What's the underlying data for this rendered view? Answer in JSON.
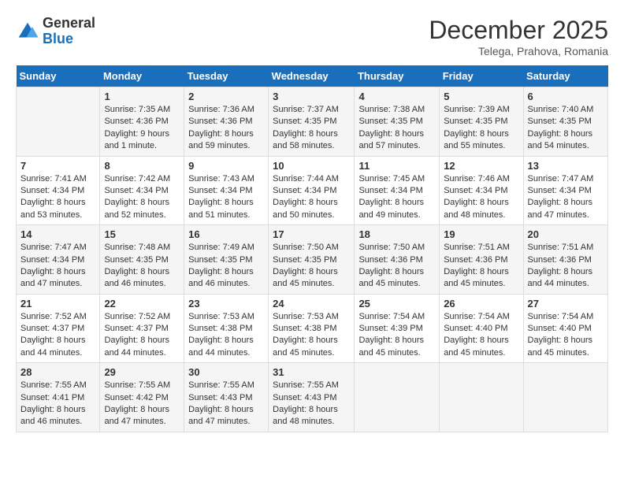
{
  "logo": {
    "general": "General",
    "blue": "Blue"
  },
  "header": {
    "month": "December 2025",
    "location": "Telega, Prahova, Romania"
  },
  "days_of_week": [
    "Sunday",
    "Monday",
    "Tuesday",
    "Wednesday",
    "Thursday",
    "Friday",
    "Saturday"
  ],
  "weeks": [
    [
      {
        "day": "",
        "info": ""
      },
      {
        "day": "1",
        "info": "Sunrise: 7:35 AM\nSunset: 4:36 PM\nDaylight: 9 hours\nand 1 minute."
      },
      {
        "day": "2",
        "info": "Sunrise: 7:36 AM\nSunset: 4:36 PM\nDaylight: 8 hours\nand 59 minutes."
      },
      {
        "day": "3",
        "info": "Sunrise: 7:37 AM\nSunset: 4:35 PM\nDaylight: 8 hours\nand 58 minutes."
      },
      {
        "day": "4",
        "info": "Sunrise: 7:38 AM\nSunset: 4:35 PM\nDaylight: 8 hours\nand 57 minutes."
      },
      {
        "day": "5",
        "info": "Sunrise: 7:39 AM\nSunset: 4:35 PM\nDaylight: 8 hours\nand 55 minutes."
      },
      {
        "day": "6",
        "info": "Sunrise: 7:40 AM\nSunset: 4:35 PM\nDaylight: 8 hours\nand 54 minutes."
      }
    ],
    [
      {
        "day": "7",
        "info": "Sunrise: 7:41 AM\nSunset: 4:34 PM\nDaylight: 8 hours\nand 53 minutes."
      },
      {
        "day": "8",
        "info": "Sunrise: 7:42 AM\nSunset: 4:34 PM\nDaylight: 8 hours\nand 52 minutes."
      },
      {
        "day": "9",
        "info": "Sunrise: 7:43 AM\nSunset: 4:34 PM\nDaylight: 8 hours\nand 51 minutes."
      },
      {
        "day": "10",
        "info": "Sunrise: 7:44 AM\nSunset: 4:34 PM\nDaylight: 8 hours\nand 50 minutes."
      },
      {
        "day": "11",
        "info": "Sunrise: 7:45 AM\nSunset: 4:34 PM\nDaylight: 8 hours\nand 49 minutes."
      },
      {
        "day": "12",
        "info": "Sunrise: 7:46 AM\nSunset: 4:34 PM\nDaylight: 8 hours\nand 48 minutes."
      },
      {
        "day": "13",
        "info": "Sunrise: 7:47 AM\nSunset: 4:34 PM\nDaylight: 8 hours\nand 47 minutes."
      }
    ],
    [
      {
        "day": "14",
        "info": "Sunrise: 7:47 AM\nSunset: 4:34 PM\nDaylight: 8 hours\nand 47 minutes."
      },
      {
        "day": "15",
        "info": "Sunrise: 7:48 AM\nSunset: 4:35 PM\nDaylight: 8 hours\nand 46 minutes."
      },
      {
        "day": "16",
        "info": "Sunrise: 7:49 AM\nSunset: 4:35 PM\nDaylight: 8 hours\nand 46 minutes."
      },
      {
        "day": "17",
        "info": "Sunrise: 7:50 AM\nSunset: 4:35 PM\nDaylight: 8 hours\nand 45 minutes."
      },
      {
        "day": "18",
        "info": "Sunrise: 7:50 AM\nSunset: 4:36 PM\nDaylight: 8 hours\nand 45 minutes."
      },
      {
        "day": "19",
        "info": "Sunrise: 7:51 AM\nSunset: 4:36 PM\nDaylight: 8 hours\nand 45 minutes."
      },
      {
        "day": "20",
        "info": "Sunrise: 7:51 AM\nSunset: 4:36 PM\nDaylight: 8 hours\nand 44 minutes."
      }
    ],
    [
      {
        "day": "21",
        "info": "Sunrise: 7:52 AM\nSunset: 4:37 PM\nDaylight: 8 hours\nand 44 minutes."
      },
      {
        "day": "22",
        "info": "Sunrise: 7:52 AM\nSunset: 4:37 PM\nDaylight: 8 hours\nand 44 minutes."
      },
      {
        "day": "23",
        "info": "Sunrise: 7:53 AM\nSunset: 4:38 PM\nDaylight: 8 hours\nand 44 minutes."
      },
      {
        "day": "24",
        "info": "Sunrise: 7:53 AM\nSunset: 4:38 PM\nDaylight: 8 hours\nand 45 minutes."
      },
      {
        "day": "25",
        "info": "Sunrise: 7:54 AM\nSunset: 4:39 PM\nDaylight: 8 hours\nand 45 minutes."
      },
      {
        "day": "26",
        "info": "Sunrise: 7:54 AM\nSunset: 4:40 PM\nDaylight: 8 hours\nand 45 minutes."
      },
      {
        "day": "27",
        "info": "Sunrise: 7:54 AM\nSunset: 4:40 PM\nDaylight: 8 hours\nand 45 minutes."
      }
    ],
    [
      {
        "day": "28",
        "info": "Sunrise: 7:55 AM\nSunset: 4:41 PM\nDaylight: 8 hours\nand 46 minutes."
      },
      {
        "day": "29",
        "info": "Sunrise: 7:55 AM\nSunset: 4:42 PM\nDaylight: 8 hours\nand 47 minutes."
      },
      {
        "day": "30",
        "info": "Sunrise: 7:55 AM\nSunset: 4:43 PM\nDaylight: 8 hours\nand 47 minutes."
      },
      {
        "day": "31",
        "info": "Sunrise: 7:55 AM\nSunset: 4:43 PM\nDaylight: 8 hours\nand 48 minutes."
      },
      {
        "day": "",
        "info": ""
      },
      {
        "day": "",
        "info": ""
      },
      {
        "day": "",
        "info": ""
      }
    ]
  ]
}
